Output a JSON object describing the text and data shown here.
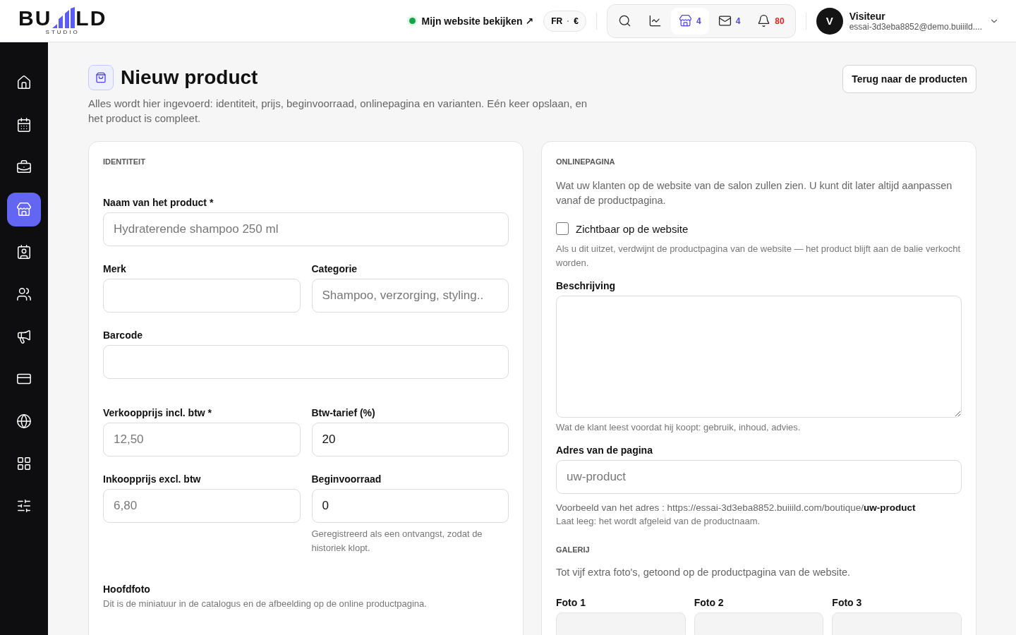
{
  "logo": {
    "left": "BU",
    "right": "LD",
    "sub": "STUDIO"
  },
  "topbar": {
    "site_link": "Mijn website bekijken ↗",
    "locale": {
      "lang": "FR",
      "sep": "·",
      "currency": "€"
    },
    "tools": [
      {
        "kind": "search",
        "selected": false
      },
      {
        "kind": "chart",
        "selected": false
      },
      {
        "kind": "store",
        "count": "4",
        "color": "#4f46e5",
        "selected": true
      },
      {
        "kind": "mail",
        "count": "4",
        "color": "#4f46e5",
        "selected": false
      },
      {
        "kind": "bell",
        "count": "80",
        "color": "#dc2626",
        "selected": false
      }
    ],
    "user": {
      "initial": "V",
      "name": "Visiteur",
      "email": "essai-3d3eba8852@demo.buiiild...."
    }
  },
  "sidebar": {
    "items": [
      {
        "kind": "home",
        "selected": false
      },
      {
        "kind": "calendar",
        "selected": false
      },
      {
        "kind": "briefcase",
        "selected": false
      },
      {
        "kind": "store",
        "selected": true
      },
      {
        "kind": "contact",
        "selected": false
      },
      {
        "kind": "users",
        "selected": false
      },
      {
        "kind": "megaphone",
        "selected": false
      },
      {
        "kind": "card",
        "selected": false
      },
      {
        "kind": "globe",
        "selected": false
      },
      {
        "kind": "grid",
        "selected": false
      },
      {
        "kind": "sliders",
        "selected": false
      }
    ]
  },
  "page": {
    "title": "Nieuw product",
    "subtitle": "Alles wordt hier ingevoerd: identiteit, prijs, beginvoorraad, onlinepagina en varianten. Eén keer opslaan, en het product is compleet.",
    "back_button": "Terug naar de producten"
  },
  "identity": {
    "section": "IDENTITEIT",
    "rows": [
      [
        {
          "label": "Naam van het product *",
          "placeholder": "Hydraterende shampoo 250 ml"
        }
      ],
      [
        {
          "label": "Merk"
        },
        {
          "label": "Categorie",
          "placeholder": "Shampoo, verzorging, styling.."
        }
      ],
      [
        {
          "label": "Barcode"
        }
      ],
      [
        {
          "label": "Verkoopprijs incl. btw *",
          "placeholder": "12,50"
        },
        {
          "label": "Btw-tarief (%)",
          "value": "20"
        }
      ],
      [
        {
          "label": "Inkoopprijs excl. btw",
          "placeholder": "6,80"
        },
        {
          "label": "Beginvoorraad",
          "value": "0",
          "hint": "Geregistreerd als een ontvangst, zodat de historiek klopt."
        }
      ]
    ],
    "photo": {
      "label": "Hoofdfoto",
      "hint": "Dit is de miniatuur in de catalogus en de afbeelding op de online productpagina."
    }
  },
  "online": {
    "section": "ONLINEPAGINA",
    "intro": "Wat uw klanten op de website van de salon zullen zien. U kunt dit later altijd aanpassen vanaf de productpagina.",
    "visible": {
      "label": "Zichtbaar op de website",
      "checked": false
    },
    "visible_hint": "Als u dit uitzet, verdwijnt de productpagina van de website — het product blijft aan de balie verkocht worden.",
    "description": {
      "label": "Beschrijving",
      "hint": "Wat de klant leest voordat hij koopt: gebruik, inhoud, advies."
    },
    "address": {
      "label": "Adres van de pagina",
      "placeholder": "uw-product",
      "preview": "Voorbeeld van het adres : https://essai-3d3eba8852.buiiild.com/boutique/**uw-product**",
      "hint": "Laat leeg: het wordt afgeleid van de productnaam."
    },
    "gallery": {
      "section": "GALERIJ",
      "intro": "Tot vijf extra foto's, getoond op de productpagina van de website.",
      "photos": [
        "Foto 1",
        "Foto 2",
        "Foto 3"
      ]
    }
  }
}
